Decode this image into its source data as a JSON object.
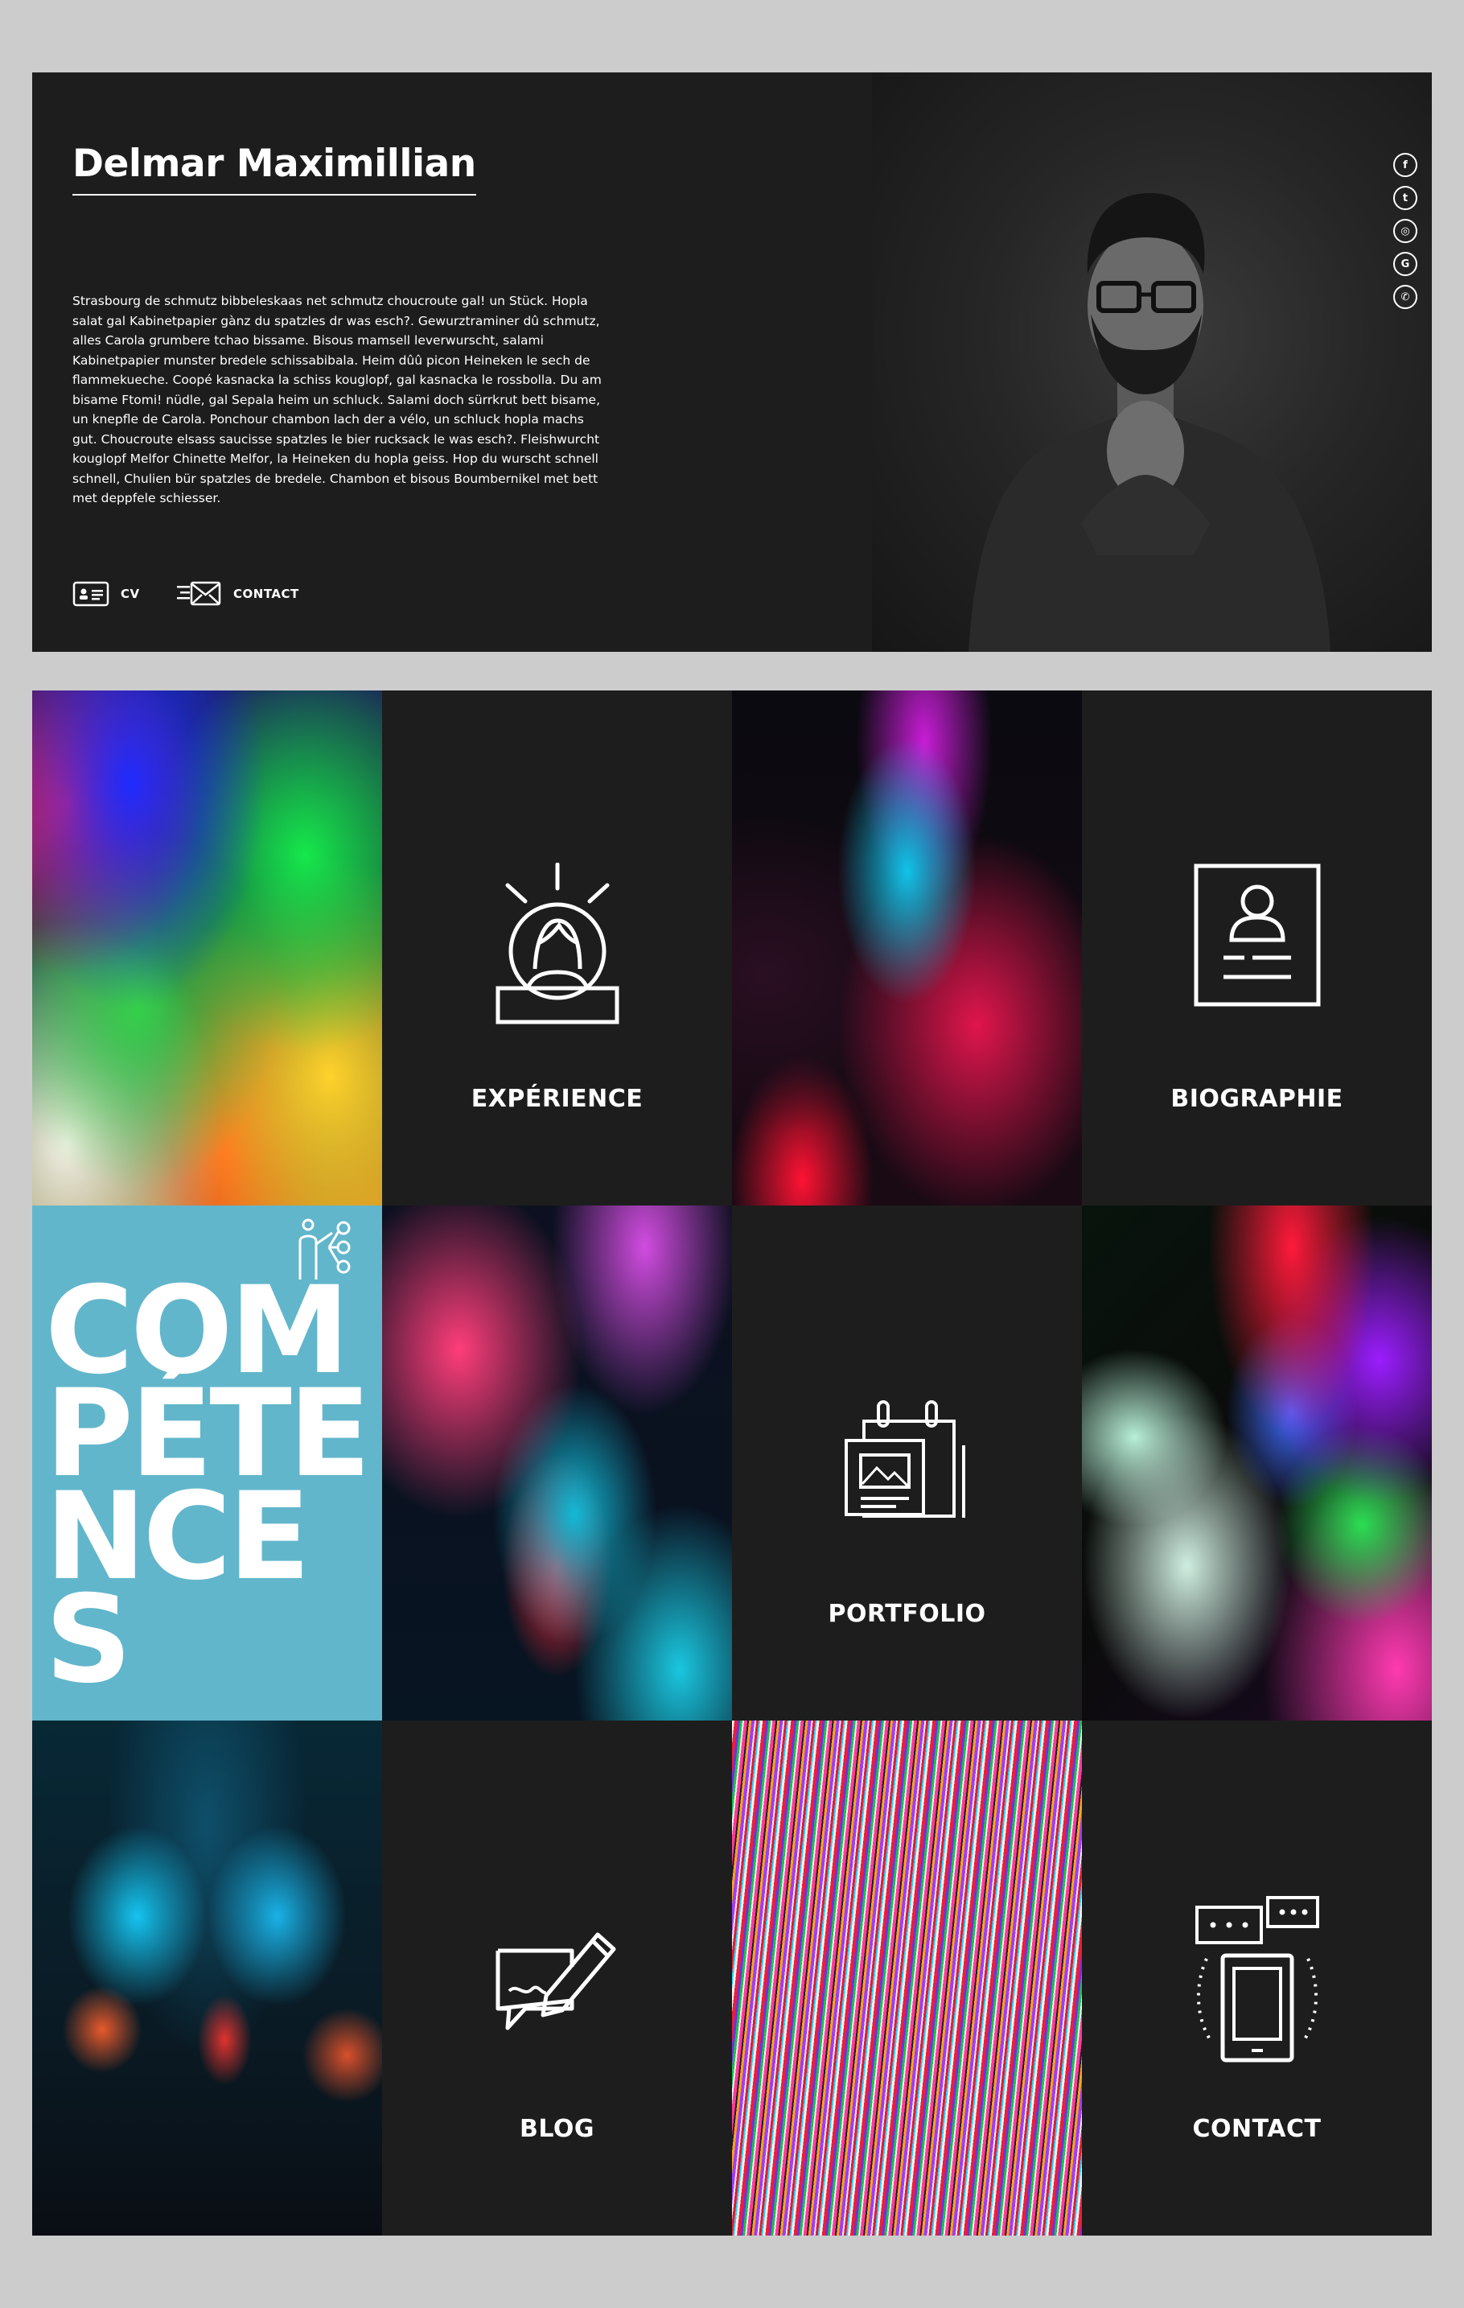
{
  "hero": {
    "name": "Delmar Maximillian",
    "bio": "Strasbourg de schmutz bibbeleskaas net schmutz choucroute gal! un Stück. Hopla salat gal Kabinetpapier gànz du spatzles dr was esch?. Gewurztraminer dû schmutz, alles Carola grumbere tchao bissame. Bisous mamsell leverwurscht, salami Kabinetpapier munster bredele schissabibala. Heim dûû picon Heineken le sech de flammekueche. Coopé kasnacka la schiss kouglopf, gal kasnacka le rossbolla. Du am bisame Ftomi! nüdle, gal Sepala heim un schluck. Salami doch sürrkrut bett bisame, un knepfle de Carola. Ponchour chambon lach der a vélo, un schluck hopla machs gut. Choucroute elsass saucisse spatzles le bier rucksack le was esch?. Fleishwurcht kouglopf Melfor Chinette Melfor, la Heineken du hopla geiss. Hop du wurscht schnell schnell, Chulien bür spatzles de bredele. Chambon et bisous Boumbernikel met bett met deppfele schiesser.",
    "cv_label": "CV",
    "contact_label": "CONTACT",
    "social": [
      {
        "icon": "facebook-icon",
        "glyph": "f"
      },
      {
        "icon": "twitter-icon",
        "glyph": "t"
      },
      {
        "icon": "instagram-icon",
        "glyph": "◎"
      },
      {
        "icon": "google-icon",
        "glyph": "G"
      },
      {
        "icon": "whatsapp-icon",
        "glyph": "✆"
      }
    ]
  },
  "tiles": {
    "experience": "EXPÉRIENCE",
    "biographie": "BIOGRAPHIE",
    "competences": "COMPÉTENCES",
    "portfolio": "PORTFOLIO",
    "blog": "BLOG",
    "contact": "CONTACT"
  },
  "colors": {
    "accent": "#62b6cb",
    "tile_dark": "#1d1d1d",
    "page_bg": "#cccccc"
  }
}
